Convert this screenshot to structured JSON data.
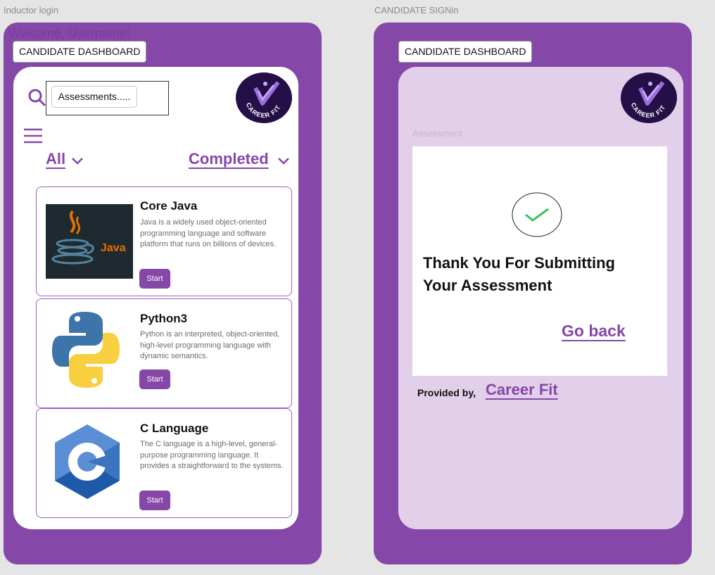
{
  "left_frame": {
    "frame_label": "Inductor login",
    "welcome": "Welcome, Username!",
    "dashboard_button": "CANDIDATE DASHBOARD",
    "search": {
      "value": "Assessments....."
    },
    "logo_text": "CAREER FIT",
    "filters": {
      "all": "All",
      "completed": "Completed"
    },
    "courses": [
      {
        "title": "Core Java",
        "desc": "Java is a widely used object-oriented programming language and software platform that runs on billions of devices.",
        "start": "Start",
        "logo_word": "Java"
      },
      {
        "title": "Python3",
        "desc": "Python is an interpreted, object-oriented, high-level programming language with dynamic semantics.",
        "start": "Start"
      },
      {
        "title": "C Language",
        "desc": "The C language is a high-level, general-purpose programming language. It provides a straightforward to the systems.",
        "start": "Start"
      }
    ]
  },
  "right_frame": {
    "frame_label": "CANDIDATE SIGNin",
    "dashboard_button": "CANDIDATE DASHBOARD",
    "logo_text": "CAREER FIT",
    "assessment_label": "Assessment",
    "thank_you": "Thank You For Submitting Your Assessment",
    "go_back": "Go back",
    "provided_by": "Provided by,",
    "provider_link": "Career Fit"
  },
  "colors": {
    "brand_purple": "#8547a8",
    "lilac": "#e2d0ea",
    "logo_bg": "#241047",
    "check_green": "#3fbf5a"
  }
}
